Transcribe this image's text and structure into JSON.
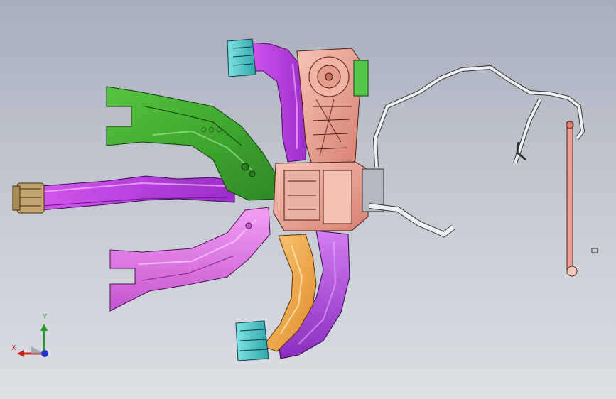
{
  "viewport": {
    "background_top": "#a7aebb",
    "background_bottom": "#dcdfe4"
  },
  "triad": {
    "x_label": "X",
    "y_label": "Y",
    "x_color": "#cc2222",
    "y_color": "#229922",
    "z_color": "#2233cc"
  },
  "model": {
    "parts": [
      {
        "name": "left-upper-duct",
        "color": "#3cab2a"
      },
      {
        "name": "left-center-duct",
        "color": "#b648d8"
      },
      {
        "name": "left-lower-duct",
        "color": "#e070e6"
      },
      {
        "name": "hvac-housing",
        "color": "#e9a89a"
      },
      {
        "name": "upper-vent-duct",
        "color": "#c63fe0"
      },
      {
        "name": "lower-vent-duct",
        "color": "#a03adc"
      },
      {
        "name": "lower-orange-duct",
        "color": "#f0a84a"
      },
      {
        "name": "vent-outlet",
        "color": "#52c8c8"
      },
      {
        "name": "wiring-harness",
        "color": "#e8e8ee"
      },
      {
        "name": "drain-tube",
        "color": "#e7a08c"
      }
    ]
  }
}
